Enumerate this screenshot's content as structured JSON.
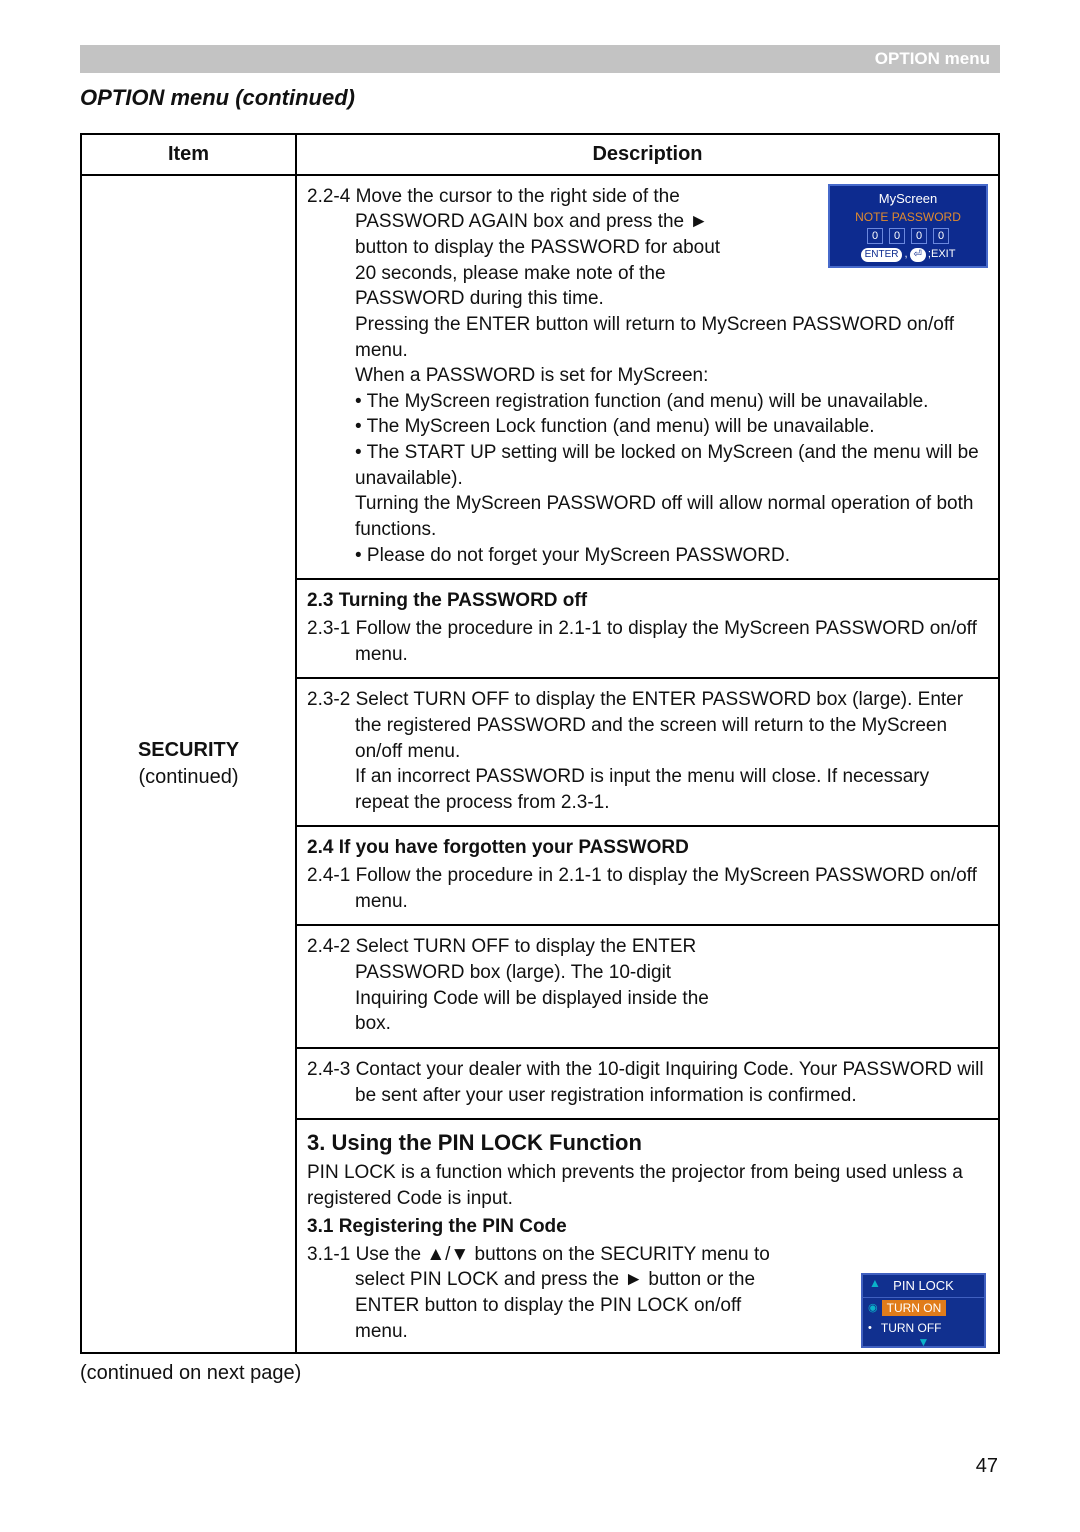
{
  "header": {
    "label": "OPTION menu"
  },
  "section_title": "OPTION menu (continued)",
  "table": {
    "col_item": "Item",
    "col_desc": "Description",
    "item_name": "SECURITY",
    "item_sub": "(continued)"
  },
  "block1": {
    "p1": "2.2-4 Move the cursor to the right side of the PASSWORD AGAIN box and press the ► button to display the PASSWORD for about 20 seconds, please make note of the PASSWORD during this time.",
    "p2": "Pressing the ENTER button will return to MyScreen PASSWORD on/off menu.",
    "p3": "When a PASSWORD is set for MyScreen:",
    "b1": "• The MyScreen registration function (and menu) will be unavailable.",
    "b2": "• The MyScreen Lock function (and menu) will be unavailable.",
    "b3": "• The START UP setting will be locked on MyScreen (and the menu will be unavailable).",
    "p4": "Turning the MyScreen PASSWORD off will allow normal operation of both functions.",
    "b4": "• Please do not forget your MyScreen PASSWORD.",
    "dlg": {
      "title": "MyScreen",
      "note": "NOTE PASSWORD",
      "d1": "0",
      "d2": "0",
      "d3": "0",
      "d4": "0",
      "foot1": "ENTER",
      "foot2": ",",
      "foot3": "⏎",
      "foot4": ";EXIT"
    }
  },
  "block2": {
    "head": "2.3 Turning the PASSWORD off",
    "p1": "2.3-1 Follow the procedure in 2.1-1 to display the MyScreen PASSWORD on/off menu."
  },
  "block3": {
    "p1": "2.3-2 Select TURN OFF to display the ENTER PASSWORD box (large). Enter the registered PASSWORD and the screen will return to the MyScreen on/off menu.",
    "p2": "If an incorrect PASSWORD is input the menu will close. If necessary repeat the process from 2.3-1."
  },
  "block4": {
    "head": "2.4 If you have forgotten your PASSWORD",
    "p1": "2.4-1 Follow the procedure in 2.1-1 to display the MyScreen PASSWORD on/off menu."
  },
  "block5": {
    "p1": "2.4-2 Select TURN OFF to display the ENTER PASSWORD box (large). The 10-digit Inquiring Code will be displayed inside the box."
  },
  "block6": {
    "p1": "2.4-3 Contact your dealer with the 10-digit Inquiring Code. Your PASSWORD will be sent after your user registration information is confirmed."
  },
  "block7": {
    "head": "3. Using the PIN LOCK Function",
    "p1": "PIN LOCK is a function which prevents the projector from being used unless a registered Code is input.",
    "sub": "3.1 Registering the PIN Code",
    "p2": "3.1-1 Use the ▲/▼ buttons on the SECURITY menu to select PIN LOCK and press the ► button or the ENTER button to display the PIN LOCK on/off menu.",
    "dlg": {
      "title": "PIN LOCK",
      "on": "TURN ON",
      "off": "TURN OFF"
    }
  },
  "footer": "(continued on next page)",
  "pagenum": "47"
}
